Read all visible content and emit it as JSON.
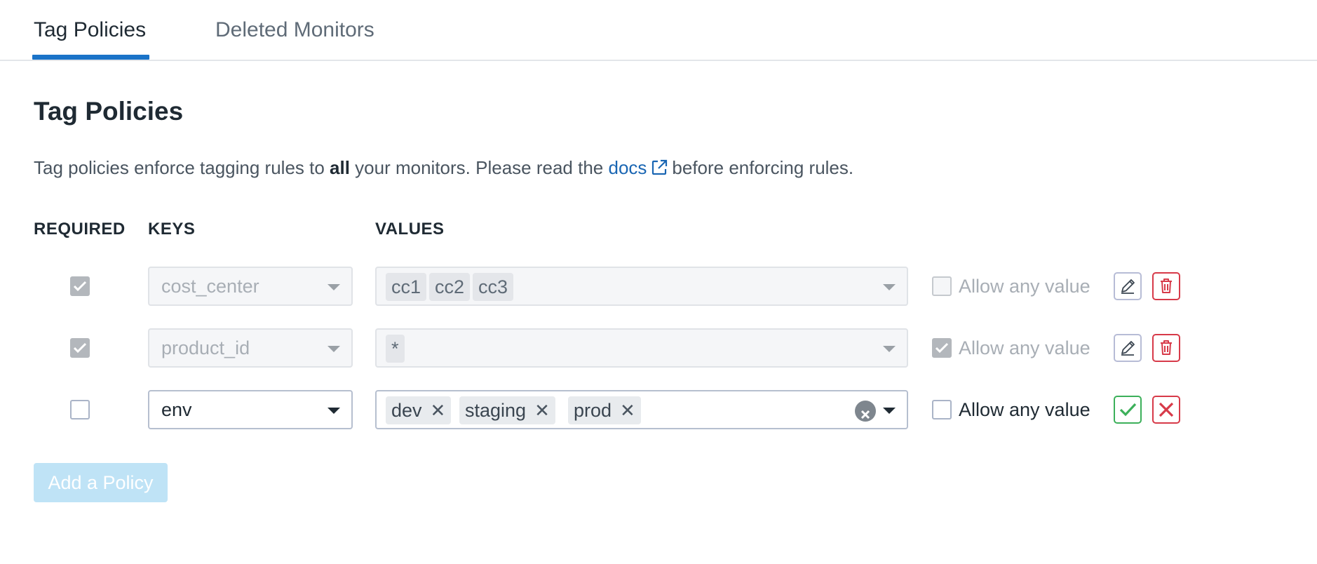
{
  "tabs": [
    {
      "label": "Tag Policies",
      "active": true
    },
    {
      "label": "Deleted Monitors",
      "active": false
    }
  ],
  "page": {
    "title": "Tag Policies",
    "intro_before": "Tag policies enforce tagging rules to ",
    "intro_bold": "all",
    "intro_middle": " your monitors. Please read the ",
    "intro_link": "docs",
    "intro_after": "before enforcing rules."
  },
  "columns": {
    "required": "REQUIRED",
    "keys": "KEYS",
    "values": "VALUES"
  },
  "policies": [
    {
      "required": true,
      "key": "cost_center",
      "values": [
        "cc1",
        "cc2",
        "cc3"
      ],
      "allow_any_label": "Allow any value",
      "allow_any": false,
      "editing": false
    },
    {
      "required": true,
      "key": "product_id",
      "values": [
        "*"
      ],
      "allow_any_label": "Allow any value",
      "allow_any": true,
      "editing": false
    },
    {
      "required": false,
      "key": "env",
      "values": [
        "dev",
        "staging",
        "prod"
      ],
      "allow_any_label": "Allow any value",
      "allow_any": false,
      "editing": true
    }
  ],
  "add_button": {
    "label": "Add a Policy",
    "disabled": true
  },
  "colors": {
    "accent": "#1a73c8",
    "link": "#1a66b3",
    "delete": "#d73a49",
    "confirm": "#3cb05a",
    "add_button_disabled": "#bfe3f6"
  },
  "icons": [
    "external-link-icon",
    "checkmark-icon",
    "chevron-down-icon",
    "pencil-icon",
    "trash-icon",
    "close-icon",
    "clear-circle-icon"
  ]
}
